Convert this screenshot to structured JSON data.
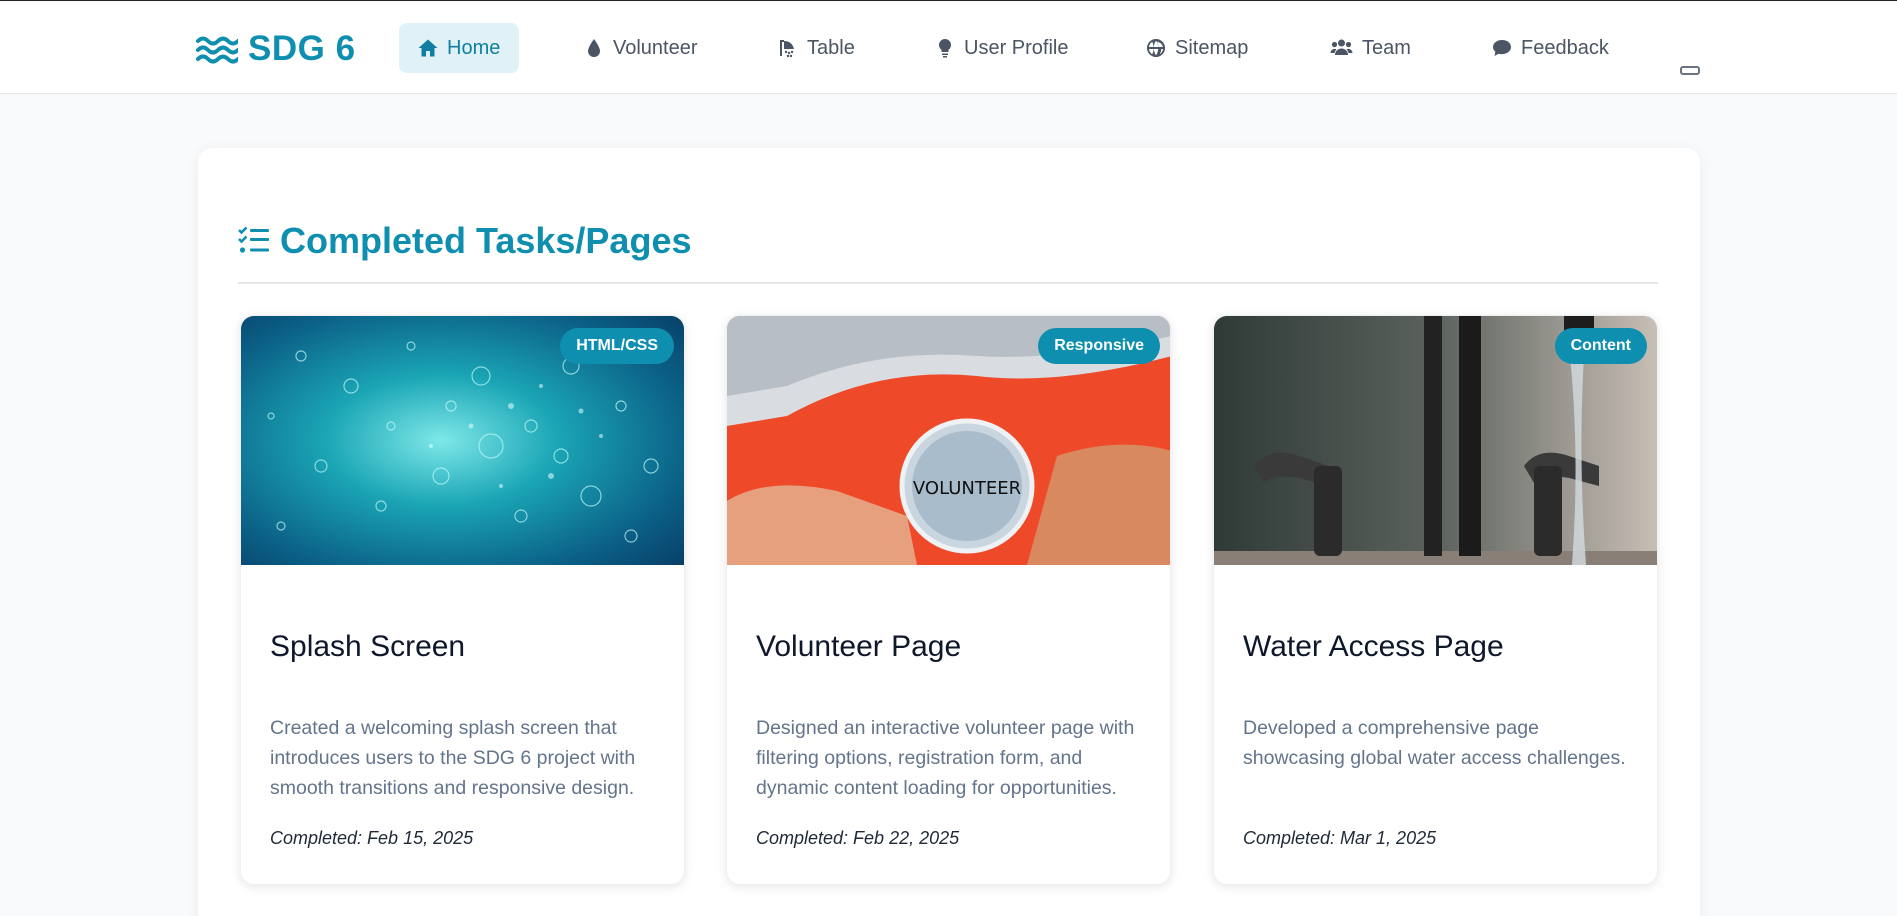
{
  "brand": {
    "name": "SDG 6",
    "icon": "water-waves-icon",
    "color": "#0e8fb0"
  },
  "nav": {
    "items": [
      {
        "label": "Home",
        "icon": "home-icon",
        "active": true
      },
      {
        "label": "Volunteer",
        "icon": "droplet-icon",
        "active": false
      },
      {
        "label": "Table",
        "icon": "shower-icon",
        "active": false
      },
      {
        "label": "User Profile",
        "icon": "lightbulb-icon",
        "active": false
      },
      {
        "label": "Sitemap",
        "icon": "globe-icon",
        "active": false
      },
      {
        "label": "Team",
        "icon": "users-icon",
        "active": false
      },
      {
        "label": "Feedback",
        "icon": "comment-icon",
        "active": false
      }
    ],
    "menu_toggle_icon": "menu-toggle-icon"
  },
  "section": {
    "title": "Completed Tasks/Pages",
    "icon": "checklist-icon"
  },
  "cards": [
    {
      "title": "Splash Screen",
      "badge": "HTML/CSS",
      "description": "Created a welcoming splash screen that introduces users to the SDG 6 project with smooth transitions and responsive design.",
      "date": "Completed: Feb 15, 2025",
      "image": "underwater-bubbles-image"
    },
    {
      "title": "Volunteer Page",
      "badge": "Responsive",
      "description": "Designed an interactive volunteer page with filtering options, registration form, and dynamic content loading for opportunities.",
      "date": "Completed: Feb 22, 2025",
      "image": "volunteer-badge-image",
      "image_text": "VOLUNTEER"
    },
    {
      "title": "Water Access Page",
      "badge": "Content",
      "description": "Developed a comprehensive page showcasing global water access challenges.",
      "date": "Completed: Mar 1, 2025",
      "image": "running-faucet-image"
    }
  ],
  "colors": {
    "accent": "#0e8fb0",
    "nav_active_bg": "#e0f2f7",
    "page_bg": "#f8fafc",
    "text_muted": "#64748b"
  }
}
